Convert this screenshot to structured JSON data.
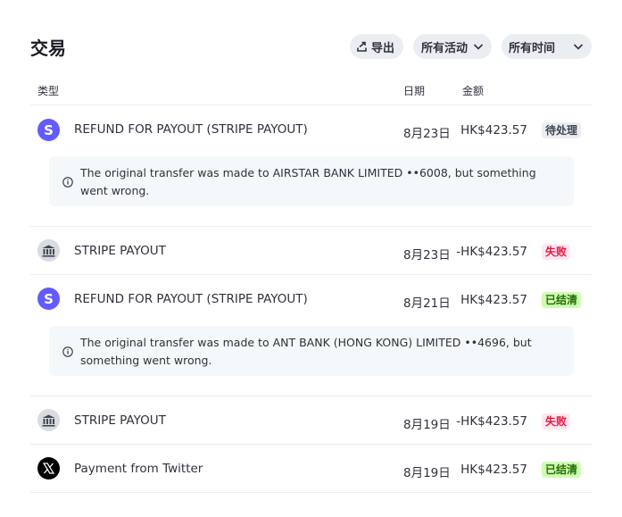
{
  "header": {
    "title": "交易",
    "export_label": "导出",
    "activity_filter": "所有活动",
    "time_filter": "所有时间"
  },
  "columns": {
    "type": "类型",
    "date": "日期",
    "amount": "金额"
  },
  "transactions": [
    {
      "icon": "stripe-icon",
      "icon_glyph": "S",
      "type": "REFUND FOR PAYOUT (STRIPE PAYOUT)",
      "date": "8月23日",
      "amount": "HK$423.57",
      "status": "待处理",
      "status_kind": "pending",
      "notice": "The original transfer was made to AIRSTAR BANK LIMITED ••6008, but something went wrong."
    },
    {
      "icon": "bank-icon",
      "type": "STRIPE PAYOUT",
      "date": "8月23日",
      "amount": "-HK$423.57",
      "status": "失败",
      "status_kind": "failed"
    },
    {
      "icon": "stripe-icon",
      "icon_glyph": "S",
      "type": "REFUND FOR PAYOUT (STRIPE PAYOUT)",
      "date": "8月21日",
      "amount": "HK$423.57",
      "status": "已结清",
      "status_kind": "cleared",
      "notice": "The original transfer was made to ANT BANK (HONG KONG) LIMITED ••4696, but something went wrong."
    },
    {
      "icon": "bank-icon",
      "type": "STRIPE PAYOUT",
      "date": "8月19日",
      "amount": "-HK$423.57",
      "status": "失败",
      "status_kind": "failed"
    },
    {
      "icon": "x-logo-icon",
      "type": "Payment from Twitter",
      "date": "8月19日",
      "amount": "HK$423.57",
      "status": "已结清",
      "status_kind": "cleared"
    }
  ],
  "colors": {
    "stripe_brand": "#635bff",
    "pending_bg": "#ebeef1",
    "failed_text": "#df1b41",
    "failed_bg": "#ffe7f2",
    "cleared_text": "#217005",
    "cleared_bg": "#d1fab3"
  }
}
